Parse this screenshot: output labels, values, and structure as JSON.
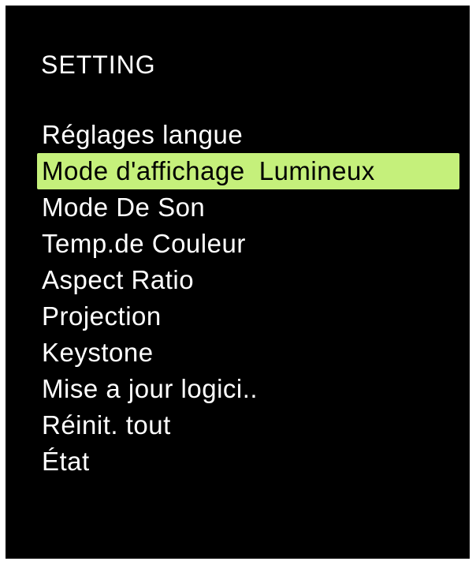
{
  "osd": {
    "title": "SETTING",
    "colors": {
      "background": "#000000",
      "text": "#ffffff",
      "highlight": "#c5f07b",
      "highlight_text": "#000000"
    },
    "items": [
      {
        "label": "Réglages langue"
      },
      {
        "label": "Mode d'affichage",
        "value": "Lumineux",
        "selected": true
      },
      {
        "label": "Mode De Son"
      },
      {
        "label": "Temp.de Couleur"
      },
      {
        "label": "Aspect Ratio"
      },
      {
        "label": "Projection"
      },
      {
        "label": "Keystone"
      },
      {
        "label": "Mise a jour logici.."
      },
      {
        "label": "Réinit. tout"
      },
      {
        "label": "État"
      }
    ]
  }
}
